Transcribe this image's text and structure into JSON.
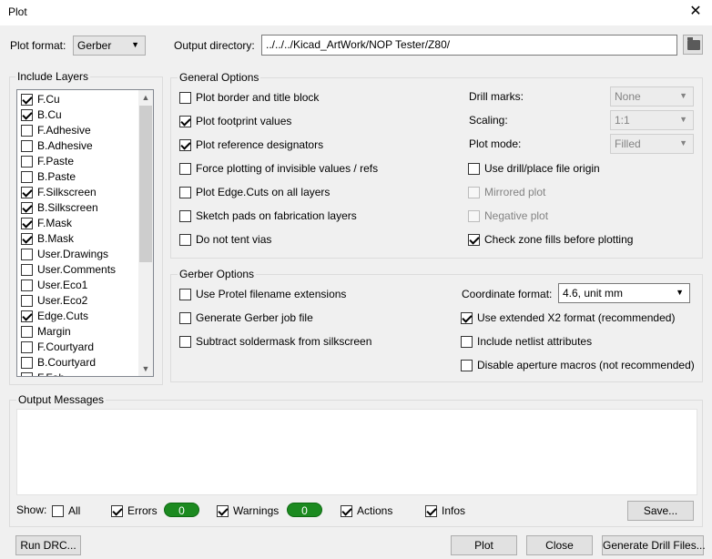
{
  "window": {
    "title": "Plot",
    "close_glyph": "✕"
  },
  "plot_format": {
    "label": "Plot format:",
    "value": "Gerber"
  },
  "output_dir": {
    "label": "Output directory:",
    "value": "../../../Kicad_ArtWork/NOP Tester/Z80/",
    "browse_icon": "folder-icon"
  },
  "layers": {
    "legend": "Include Layers",
    "items": [
      {
        "label": "F.Cu",
        "checked": true
      },
      {
        "label": "B.Cu",
        "checked": true
      },
      {
        "label": "F.Adhesive",
        "checked": false
      },
      {
        "label": "B.Adhesive",
        "checked": false
      },
      {
        "label": "F.Paste",
        "checked": false
      },
      {
        "label": "B.Paste",
        "checked": false
      },
      {
        "label": "F.Silkscreen",
        "checked": true
      },
      {
        "label": "B.Silkscreen",
        "checked": true
      },
      {
        "label": "F.Mask",
        "checked": true
      },
      {
        "label": "B.Mask",
        "checked": true
      },
      {
        "label": "User.Drawings",
        "checked": false
      },
      {
        "label": "User.Comments",
        "checked": false
      },
      {
        "label": "User.Eco1",
        "checked": false
      },
      {
        "label": "User.Eco2",
        "checked": false
      },
      {
        "label": "Edge.Cuts",
        "checked": true
      },
      {
        "label": "Margin",
        "checked": false
      },
      {
        "label": "F.Courtyard",
        "checked": false
      },
      {
        "label": "B.Courtyard",
        "checked": false
      },
      {
        "label": "F.Fab",
        "checked": false
      }
    ]
  },
  "general": {
    "legend": "General Options",
    "left": [
      {
        "label": "Plot border and title block",
        "checked": false
      },
      {
        "label": "Plot footprint values",
        "checked": true
      },
      {
        "label": "Plot reference designators",
        "checked": true
      },
      {
        "label": "Force plotting of invisible values / refs",
        "checked": false
      },
      {
        "label": "Plot Edge.Cuts on all layers",
        "checked": false
      },
      {
        "label": "Sketch pads on fabrication layers",
        "checked": false
      },
      {
        "label": "Do not tent vias",
        "checked": false
      }
    ],
    "drill_marks": {
      "label": "Drill marks:",
      "value": "None"
    },
    "scaling": {
      "label": "Scaling:",
      "value": "1:1"
    },
    "plot_mode": {
      "label": "Plot mode:",
      "value": "Filled"
    },
    "right": [
      {
        "label": "Use drill/place file origin",
        "checked": false,
        "disabled": false
      },
      {
        "label": "Mirrored plot",
        "checked": false,
        "disabled": true
      },
      {
        "label": "Negative plot",
        "checked": false,
        "disabled": true
      },
      {
        "label": "Check zone fills before plotting",
        "checked": true,
        "disabled": false
      }
    ]
  },
  "gerber": {
    "legend": "Gerber Options",
    "left": [
      {
        "label": "Use Protel filename extensions",
        "checked": false
      },
      {
        "label": "Generate Gerber job file",
        "checked": false
      },
      {
        "label": "Subtract soldermask from silkscreen",
        "checked": false
      }
    ],
    "coord_format": {
      "label": "Coordinate format:",
      "value": "4.6, unit mm"
    },
    "right": [
      {
        "label": "Use extended X2 format (recommended)",
        "checked": true
      },
      {
        "label": "Include netlist attributes",
        "checked": false
      },
      {
        "label": "Disable aperture macros (not recommended)",
        "checked": false
      }
    ]
  },
  "messages": {
    "legend": "Output Messages",
    "show_label": "Show:",
    "filters": {
      "all": {
        "label": "All",
        "checked": false
      },
      "errors": {
        "label": "Errors",
        "checked": true,
        "count": "0"
      },
      "warnings": {
        "label": "Warnings",
        "checked": true,
        "count": "0"
      },
      "actions": {
        "label": "Actions",
        "checked": true
      },
      "infos": {
        "label": "Infos",
        "checked": true
      }
    },
    "save_label": "Save..."
  },
  "buttons": {
    "run_drc": "Run DRC...",
    "plot": "Plot",
    "close": "Close",
    "generate_drill": "Generate Drill Files..."
  },
  "colors": {
    "badge_green": "#1c8a20",
    "dialog_bg": "#f0f0f0"
  }
}
